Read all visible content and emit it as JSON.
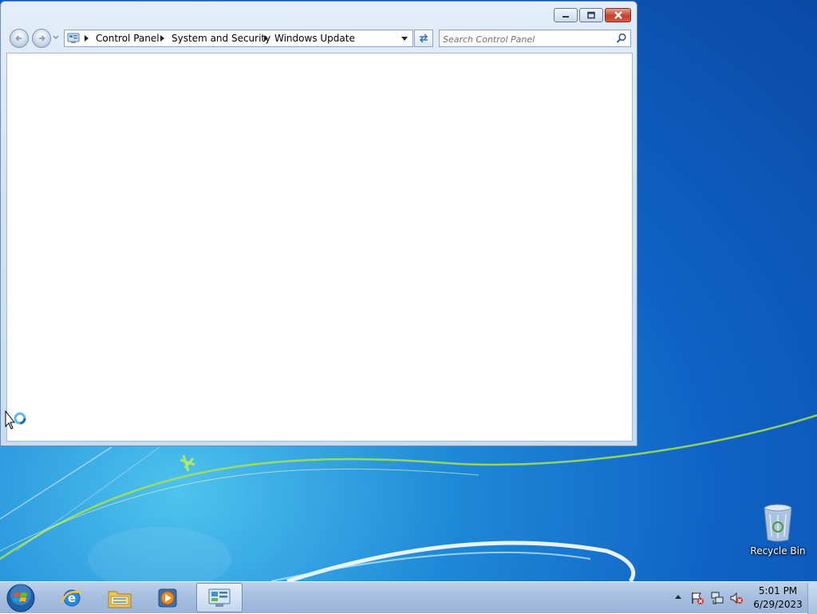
{
  "window": {
    "breadcrumbs": [
      "Control Panel",
      "System and Security",
      "Windows Update"
    ],
    "search": {
      "placeholder": "Search Control Panel"
    },
    "buttons": {
      "minimize": "minimize-icon",
      "maximize": "restore-icon",
      "close": "close-icon"
    }
  },
  "desktop": {
    "icons": [
      {
        "label": "Recycle Bin",
        "icon": "recycle-bin-icon"
      }
    ]
  },
  "taskbar": {
    "items": [
      "start-orb-icon",
      "internet-explorer-icon",
      "windows-explorer-icon",
      "windows-media-player-icon",
      "control-panel-icon"
    ],
    "tray": [
      "show-hidden-icons",
      "action-center-flag-icon",
      "network-icon",
      "volume-muted-icon"
    ],
    "clock": {
      "time": "5:01 PM",
      "date": "6/29/2023"
    }
  },
  "colors": {
    "desktop": "#0f62c4",
    "window_frame": "#d3e3f5",
    "taskbar": "#a7bfdf"
  }
}
